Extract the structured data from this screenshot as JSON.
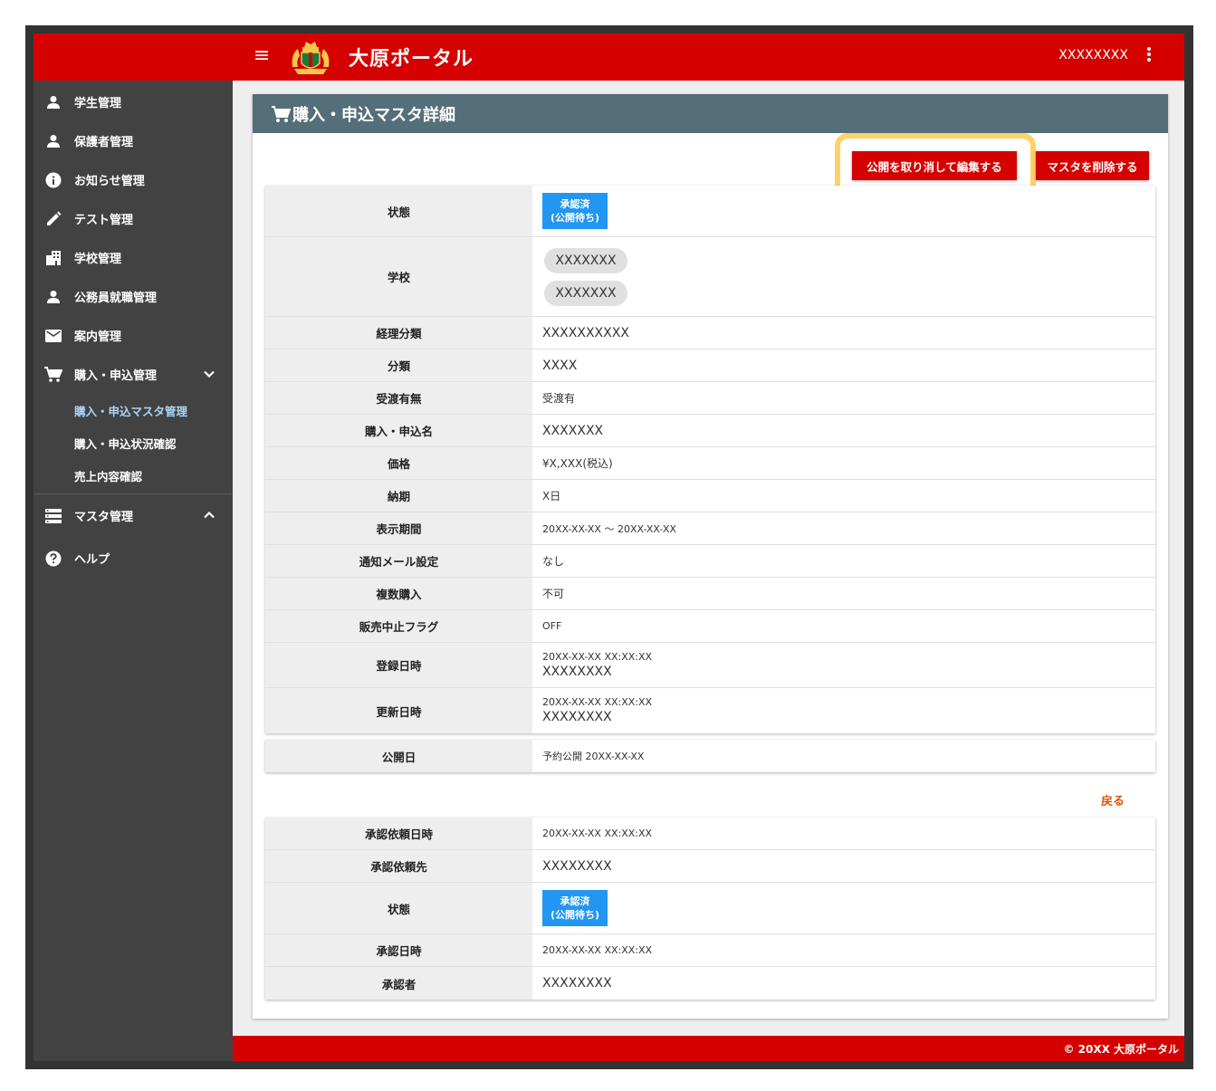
{
  "header": {
    "app_title": "大原ポータル",
    "user_name": "XXXXXXXX",
    "brand_color": "#d50000"
  },
  "sidebar": {
    "items": [
      {
        "label": "学生管理",
        "icon": "person-icon"
      },
      {
        "label": "保護者管理",
        "icon": "person-icon"
      },
      {
        "label": "お知らせ管理",
        "icon": "info-icon"
      },
      {
        "label": "テスト管理",
        "icon": "pencil-icon"
      },
      {
        "label": "学校管理",
        "icon": "building-icon"
      },
      {
        "label": "公務員就職管理",
        "icon": "person-icon"
      },
      {
        "label": "案内管理",
        "icon": "mail-icon"
      },
      {
        "label": "購入・申込管理",
        "icon": "cart-icon"
      }
    ],
    "sub_items": [
      {
        "label": "購入・申込マスタ管理"
      },
      {
        "label": "購入・申込状況確認"
      },
      {
        "label": "売上内容確認"
      }
    ],
    "master": {
      "label": "マスタ管理",
      "icon": "storage-icon"
    },
    "help": {
      "label": "ヘルプ",
      "icon": "help-icon"
    }
  },
  "card": {
    "title": "購入・申込マスタ詳細",
    "unpublish_edit_button": "公開を取り消して編集する",
    "delete_button": "マスタを削除する",
    "back_link": "戻る"
  },
  "detail": {
    "status_label": "状態",
    "status_badge_line1": "承認済",
    "status_badge_line2": "(公開待ち)",
    "school_label": "学校",
    "schools": [
      "XXXXXXX",
      "XXXXXXX"
    ],
    "accounting_label": "経理分類",
    "accounting_value": "XXXXXXXXXX",
    "category_label": "分類",
    "category_value": "XXXX",
    "delivery_label": "受渡有無",
    "delivery_value": "受渡有",
    "name_label": "購入・申込名",
    "name_value": "XXXXXXX",
    "price_label": "価格",
    "price_value": "¥X,XXX(税込)",
    "due_label": "納期",
    "due_value": "X日",
    "period_label": "表示期間",
    "period_value": "20XX-XX-XX ～ 20XX-XX-XX",
    "mail_label": "通知メール設定",
    "mail_value": "なし",
    "multi_label": "複数購入",
    "multi_value": "不可",
    "stop_label": "販売中止フラグ",
    "stop_value": "OFF",
    "registered_label": "登録日時",
    "registered_datetime": "20XX-XX-XX XX:XX:XX",
    "registered_user": "XXXXXXXX",
    "updated_label": "更新日時",
    "updated_datetime": "20XX-XX-XX XX:XX:XX",
    "updated_user": "XXXXXXXX"
  },
  "publish": {
    "label": "公開日",
    "value": "予約公開 20XX-XX-XX"
  },
  "approval": {
    "request_datetime_label": "承認依頼日時",
    "request_datetime_value": "20XX-XX-XX XX:XX:XX",
    "request_to_label": "承認依頼先",
    "request_to_value": "XXXXXXXX",
    "status_label": "状態",
    "status_badge_line1": "承認済",
    "status_badge_line2": "(公開待ち)",
    "approved_datetime_label": "承認日時",
    "approved_datetime_value": "20XX-XX-XX XX:XX:XX",
    "approver_label": "承認者",
    "approver_value": "XXXXXXXX"
  },
  "footer": {
    "copyright": "© 20XX 大原ポータル"
  }
}
